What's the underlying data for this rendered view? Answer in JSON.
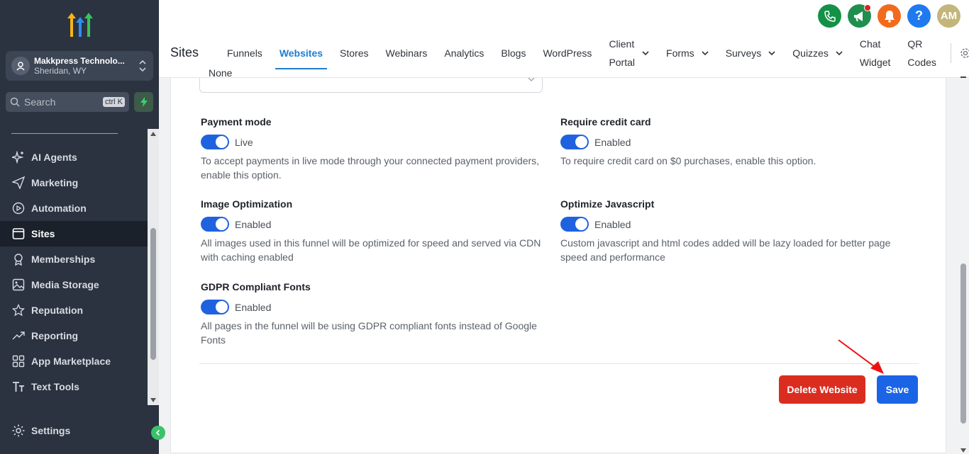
{
  "sidebar": {
    "account": {
      "name": "Makkpress Technolo...",
      "location": "Sheridan, WY"
    },
    "search": {
      "placeholder": "Search",
      "shortcut": "ctrl K"
    },
    "items": [
      {
        "label": "AI Agents",
        "icon": "sparkle-icon"
      },
      {
        "label": "Marketing",
        "icon": "send-icon"
      },
      {
        "label": "Automation",
        "icon": "play-circle-icon"
      },
      {
        "label": "Sites",
        "icon": "sites-icon",
        "active": true
      },
      {
        "label": "Memberships",
        "icon": "award-icon"
      },
      {
        "label": "Media Storage",
        "icon": "image-icon"
      },
      {
        "label": "Reputation",
        "icon": "star-icon"
      },
      {
        "label": "Reporting",
        "icon": "trend-icon"
      },
      {
        "label": "App Marketplace",
        "icon": "grid-icon"
      },
      {
        "label": "Text Tools",
        "icon": "text-icon"
      }
    ],
    "settings_label": "Settings"
  },
  "header": {
    "title": "Sites",
    "tabs": [
      "Funnels",
      "Websites",
      "Stores",
      "Webinars",
      "Analytics",
      "Blogs",
      "WordPress"
    ],
    "dropdown_tabs": [
      {
        "line1": "Client",
        "line2": "Portal"
      },
      {
        "line1": "Forms"
      },
      {
        "line1": "Surveys"
      },
      {
        "line1": "Quizzes"
      }
    ],
    "chat_widget": {
      "line1": "Chat",
      "line2": "Widget"
    },
    "qr_codes": {
      "line1": "QR",
      "line2": "Codes"
    },
    "avatar_initials": "AM",
    "help_label": "?",
    "colors": {
      "phone": "#149146",
      "megaphone": "#1f8f4e",
      "bell": "#f26b1d",
      "help": "#1f7af0",
      "avatar": "#c4b57a"
    }
  },
  "form": {
    "select_value": "None",
    "options": [
      {
        "label": "Payment mode",
        "state": "Live",
        "desc": "To accept payments in live mode through your connected payment providers, enable this option."
      },
      {
        "label": "Require credit card",
        "state": "Enabled",
        "desc": "To require credit card on $0 purchases, enable this option."
      },
      {
        "label": "Image Optimization",
        "state": "Enabled",
        "desc": "All images used in this funnel will be optimized for speed and served via CDN with caching enabled"
      },
      {
        "label": "Optimize Javascript",
        "state": "Enabled",
        "desc": "Custom javascript and html codes added will be lazy loaded for better page speed and performance"
      },
      {
        "label": "GDPR Compliant Fonts",
        "state": "Enabled",
        "desc": "All pages in the funnel will be using GDPR compliant fonts instead of Google Fonts"
      }
    ],
    "delete_label": "Delete Website",
    "save_label": "Save"
  }
}
